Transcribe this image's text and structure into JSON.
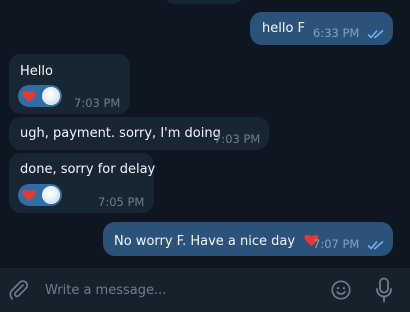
{
  "messages": [
    {
      "text": "hello F",
      "time": "6:33 PM",
      "direction": "out",
      "status": "read"
    },
    {
      "text": "Hello",
      "time": "7:03 PM",
      "direction": "in",
      "reaction": "heart"
    },
    {
      "text": "ugh, payment. sorry, I'm doing",
      "time": "7:03 PM",
      "direction": "in"
    },
    {
      "text": "done, sorry for delay",
      "time": "7:05 PM",
      "direction": "in",
      "reaction": "heart"
    },
    {
      "text": "No worry F. Have a nice day",
      "emoji": "heart",
      "time": "7:07 PM",
      "direction": "out",
      "status": "read"
    }
  ],
  "composer": {
    "placeholder": "Write a message..."
  },
  "colors": {
    "background": "#0e1621",
    "incoming_bubble": "#182533",
    "outgoing_bubble": "#2b5278",
    "reaction_pill": "#2f6ea5",
    "composer_bg": "#17212b",
    "read_ticks": "#6ab2f2",
    "heart": "#e53935"
  }
}
